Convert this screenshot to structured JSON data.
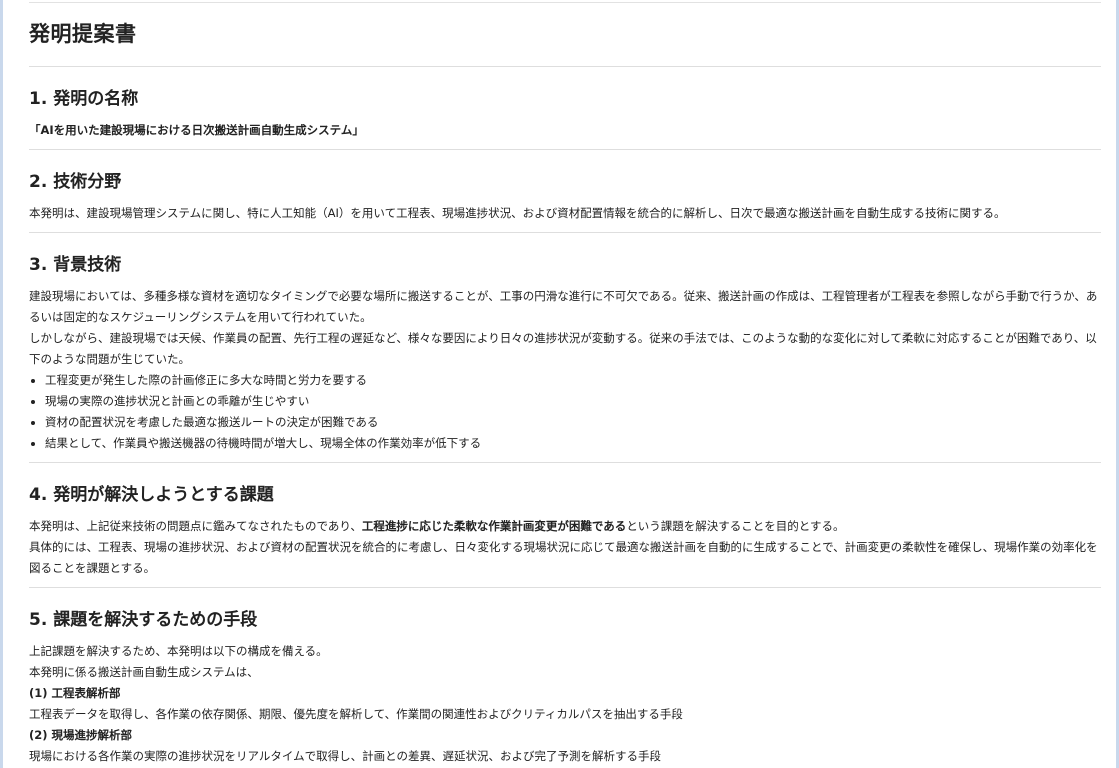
{
  "document": {
    "title": "発明提案書"
  },
  "sections": {
    "s1": {
      "heading": "1. 発明の名称",
      "name": "「AIを用いた建設現場における日次搬送計画自動生成システム」"
    },
    "s2": {
      "heading": "2. 技術分野",
      "body": "本発明は、建設現場管理システムに関し、特に人工知能（AI）を用いて工程表、現場進捗状況、および資材配置情報を統合的に解析し、日次で最適な搬送計画を自動生成する技術に関する。"
    },
    "s3": {
      "heading": "3. 背景技術",
      "para1": "建設現場においては、多種多様な資材を適切なタイミングで必要な場所に搬送することが、工事の円滑な進行に不可欠である。従来、搬送計画の作成は、工程管理者が工程表を参照しながら手動で行うか、あるいは固定的なスケジューリングシステムを用いて行われていた。",
      "para2": "しかしながら、建設現場では天候、作業員の配置、先行工程の遅延など、様々な要因により日々の進捗状況が変動する。従来の手法では、このような動的な変化に対して柔軟に対応することが困難であり、以下のような問題が生じていた。",
      "bullets": [
        "工程変更が発生した際の計画修正に多大な時間と労力を要する",
        "現場の実際の進捗状況と計画との乖離が生じやすい",
        "資材の配置状況を考慮した最適な搬送ルートの決定が困難である",
        "結果として、作業員や搬送機器の待機時間が増大し、現場全体の作業効率が低下する"
      ]
    },
    "s4": {
      "heading": "4. 発明が解決しようとする課題",
      "p1_pre": "本発明は、上記従来技術の問題点に鑑みてなされたものであり、",
      "p1_bold": "工程進捗に応じた柔軟な作業計画変更が困難である",
      "p1_post": "という課題を解決することを目的とする。",
      "para2": "具体的には、工程表、現場の進捗状況、および資材の配置状況を統合的に考慮し、日々変化する現場状況に応じて最適な搬送計画を自動的に生成することで、計画変更の柔軟性を確保し、現場作業の効率化を図ることを課題とする。"
    },
    "s5": {
      "heading": "5. 課題を解決するための手段",
      "line1": "上記課題を解決するため、本発明は以下の構成を備える。",
      "line2": "本発明に係る搬送計画自動生成システムは、",
      "item1_title": "(1) 工程表解析部",
      "item1_body": "工程表データを取得し、各作業の依存関係、期限、優先度を解析して、作業間の関連性およびクリティカルパスを抽出する手段",
      "item2_title": "(2) 現場進捗解析部",
      "item2_body": "現場における各作業の実際の進捗状況をリアルタイムで取得し、計画との差異、遅延状況、および完了予測を解析する手段"
    }
  }
}
